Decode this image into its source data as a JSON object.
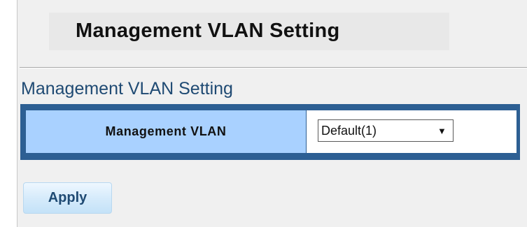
{
  "page": {
    "title": "Management VLAN Setting"
  },
  "section": {
    "title": "Management VLAN Setting"
  },
  "form": {
    "management_vlan_label": "Management VLAN",
    "management_vlan_value": "Default(1)",
    "select_arrow_glyph": "▼"
  },
  "actions": {
    "apply_label": "Apply"
  },
  "colors": {
    "header_blue": "#1f4a73",
    "table_border": "#2d5f93",
    "label_cell": "#a9d1ff",
    "panel_bg": "#f0f0f0"
  },
  "icons": {
    "select_arrow": "chevron-down-icon"
  }
}
